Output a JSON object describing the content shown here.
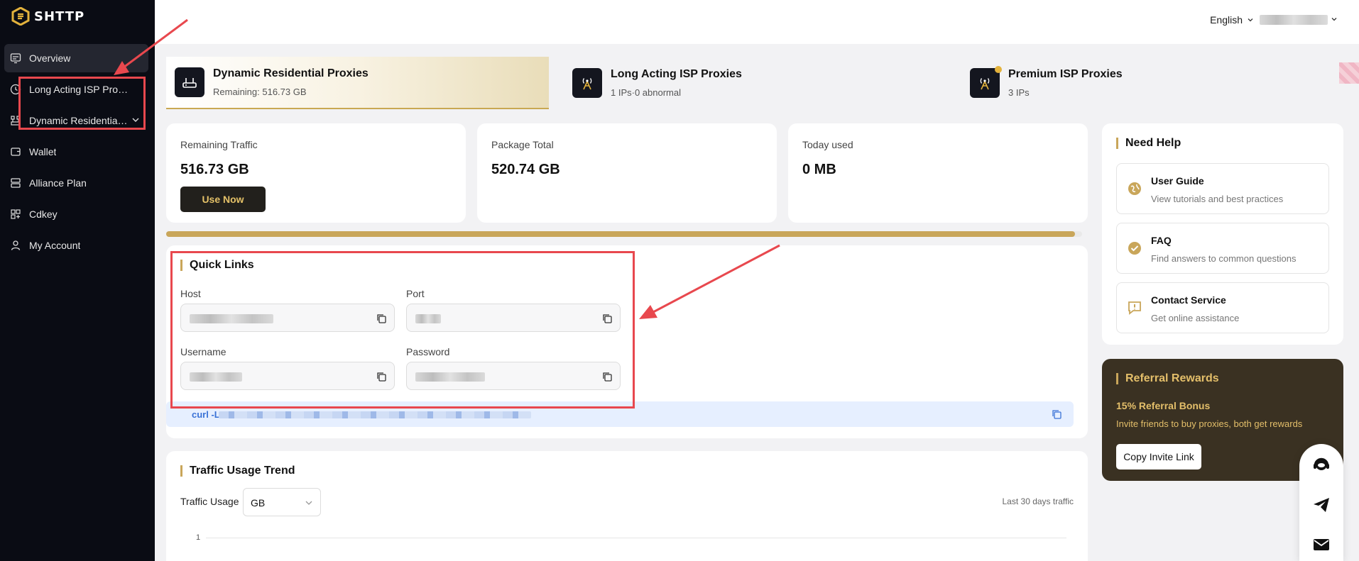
{
  "brand": {
    "name": "SHTTP"
  },
  "sidebar": {
    "items": [
      {
        "label": "Overview",
        "icon": "overview-icon",
        "active": true
      },
      {
        "label": "Long Acting ISP Proxies",
        "icon": "clock-icon"
      },
      {
        "label": "Dynamic Residential Proxies",
        "icon": "network-icon",
        "expandable": true
      },
      {
        "label": "Wallet",
        "icon": "wallet-icon"
      },
      {
        "label": "Alliance Plan",
        "icon": "server-icon"
      },
      {
        "label": "Cdkey",
        "icon": "key-icon"
      },
      {
        "label": "My Account",
        "icon": "user-icon"
      }
    ]
  },
  "topbar": {
    "language": "English"
  },
  "products": [
    {
      "title": "Dynamic Residential Proxies",
      "subtitle": "Remaining: 516.73 GB",
      "active": true
    },
    {
      "title": "Long Acting ISP Proxies",
      "subtitle": "1 IPs·0 abnormal"
    },
    {
      "title": "Premium ISP Proxies",
      "subtitle": "3 IPs"
    }
  ],
  "stats": [
    {
      "label": "Remaining Traffic",
      "value": "516.73 GB",
      "action": "Use Now"
    },
    {
      "label": "Package Total",
      "value": "520.74 GB"
    },
    {
      "label": "Today used",
      "value": "0 MB"
    }
  ],
  "traffic_progress": 0.992,
  "quick_links": {
    "title": "Quick Links",
    "host_label": "Host",
    "port_label": "Port",
    "username_label": "Username",
    "password_label": "Password",
    "curl_prefix": "curl -L"
  },
  "help": {
    "title": "Need Help",
    "items": [
      {
        "title": "User Guide",
        "subtitle": "View tutorials and best practices",
        "icon": "globe-icon"
      },
      {
        "title": "FAQ",
        "subtitle": "Find answers to common questions",
        "icon": "check-circle-icon"
      },
      {
        "title": "Contact Service",
        "subtitle": "Get online assistance",
        "icon": "chat-alert-icon"
      }
    ]
  },
  "referral": {
    "title": "Referral Rewards",
    "bonus": "15% Referral Bonus",
    "description": "Invite friends to buy proxies, both get rewards",
    "button": "Copy Invite Link"
  },
  "trend": {
    "title": "Traffic Usage Trend",
    "filter_label": "Traffic Usage",
    "unit": "GB",
    "range_note": "Last 30 days traffic",
    "y_tick": "1"
  },
  "colors": {
    "accent": "#c9a65a",
    "sidebar_bg": "#0a0c14",
    "annotation": "#e8484e"
  }
}
